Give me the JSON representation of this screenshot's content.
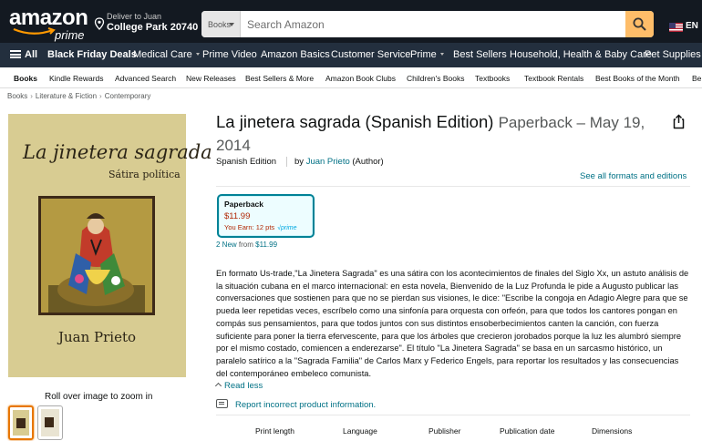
{
  "header": {
    "logo_word": "amazon",
    "logo_sub": "prime",
    "deliver_line1": "Deliver to Juan",
    "deliver_line2": "College Park 20740",
    "search_category": "Books",
    "search_placeholder": "Search Amazon",
    "language": "EN"
  },
  "subnav": {
    "all_label": "All",
    "items": [
      "Black Friday Deals",
      "Medical Care",
      "Prime Video",
      "Amazon Basics",
      "Customer Service",
      "Prime",
      "Best Sellers",
      "Household, Health & Baby Care",
      "Pet Supplies"
    ]
  },
  "categories": [
    "Books",
    "Kindle Rewards",
    "Advanced Search",
    "New Releases",
    "Best Sellers & More",
    "Amazon Book Clubs",
    "Children's Books",
    "Textbooks",
    "Textbook Rentals",
    "Best Books of the Month",
    "Be"
  ],
  "breadcrumb": [
    "Books",
    "Literature & Fiction",
    "Contemporary"
  ],
  "cover": {
    "title": "La jinetera sagrada",
    "subtitle": "Sátira política",
    "author": "Juan Prieto"
  },
  "gallery": {
    "zoom_hint": "Roll over image to zoom in"
  },
  "product": {
    "title": "La jinetera sagrada (Spanish Edition)",
    "format_date": "Paperback – May 19, 2014",
    "edition": "Spanish Edition",
    "by_prefix": "by",
    "author": "Juan Prieto",
    "author_role": "(Author)",
    "see_all_formats": "See all formats and editions",
    "format_name": "Paperback",
    "format_price": "$11.99",
    "earn_text": "You Earn: 12 pts",
    "prime_badge": "√prime",
    "new_from_count": "2 New",
    "new_from_word": "from",
    "new_from_price": "$11.99",
    "description": "En formato Us-trade,\"La Jinetera Sagrada\" es una sátira con los acontecimientos de finales del Siglo Xx, un astuto análisis de la situación cubana en el marco internacional: en esta novela, Bienvenido de la Luz Profunda le pide a Augusto publicar las conversaciones que sostienen para que no se pierdan sus visiones, le dice: \"Escribe la congoja en Adagio Alegre para que se pueda leer repetidas veces, escríbelo como una sinfonía para orquesta con orfeón, para que todos los cantores pongan en compás sus pensamientos, para que todos juntos con sus distintos ensoberbecimientos canten la canción, con fuerza suficiente para poner la tierra efervescente, para que los árboles que crecieron jorobados porque la luz les alumbró siempre por el mismo costado, comiencen a enderezarse\". El título \"La Jinetera Sagrada\" se basa en un sarcasmo histórico, un paralelo satírico a la \"Sagrada Familia\" de Carlos Marx y Federico Engels, para reportar los resultados y las consecuencias del contemporáneo embeleco comunista.",
    "read_less": "Read less",
    "report_link": "Report incorrect product information."
  },
  "attributes": [
    "Print length",
    "Language",
    "Publisher",
    "Publication date",
    "Dimensions"
  ],
  "colors": {
    "nav_dark": "#131921",
    "nav_sub": "#232f3e",
    "search_button": "#febd69",
    "link": "#007185",
    "price": "#b12704",
    "selected_border": "#008296",
    "cover_bg": "#d8cc92"
  },
  "icons": {
    "search": "search-icon",
    "location": "location-pin-icon",
    "share": "share-icon",
    "menu": "hamburger-icon",
    "report": "report-icon",
    "flag": "us-flag-icon"
  }
}
